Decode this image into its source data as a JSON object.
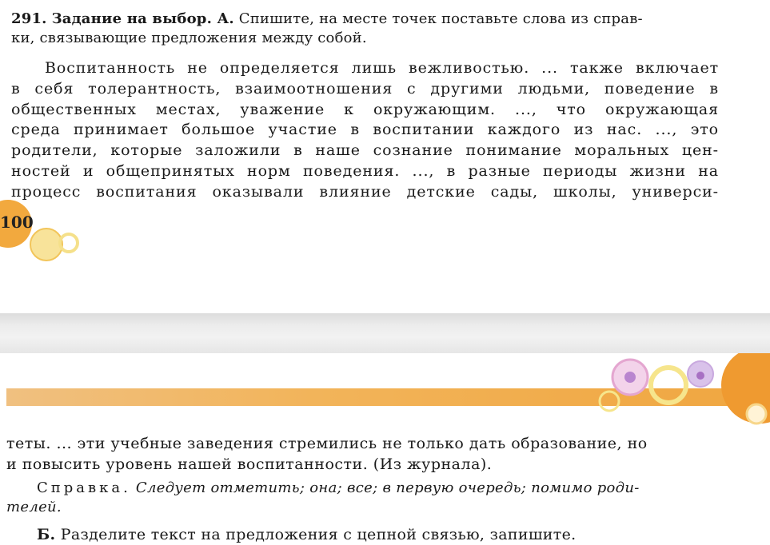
{
  "page_top": {
    "task_number": "291.",
    "task_heading": "Задание на выбор. А.",
    "task_instruction_line1": "Спишите, на месте точек поставьте слова из справ-",
    "task_instruction_line2": "ки, связывающие предложения между собой.",
    "paragraph_lines": [
      "Воспитанность не определяется лишь вежливостью. ... также включает",
      "в себя толерантность, взаимоотношения с другими людьми, поведение в",
      "общественных местах, уважение к окружающим.  ..., что окружающая",
      "среда принимает большое участие в воспитании каждого из нас. ..., это",
      "родители, которые заложили в наше сознание понимание моральных цен-",
      "ностей и общепринятых норм поведения. ..., в разные периоды жизни на",
      "процесс воспитания оказывали влияние детские сады, школы, универси-"
    ],
    "page_number": "100"
  },
  "page_bottom": {
    "continuation_line1": "теты. ... эти учебные заведения стремились не только дать образование, но",
    "continuation_line2": "и повысить уровень  нашей воспитанности. (Из журнала).",
    "reference_label": "Справка.",
    "reference_line1": "Следует отметить; она; все; в первую очередь; помимо роди-",
    "reference_line2": "телей.",
    "task_b_heading": "Б.",
    "task_b_text": "Разделите текст на предложения с цепной связью, запишите."
  },
  "colors": {
    "accent_orange": "#f0a640",
    "circle_yellow": "#f7e27a",
    "circle_pink": "#e8b4d8",
    "circle_purple": "#b07cc8"
  }
}
